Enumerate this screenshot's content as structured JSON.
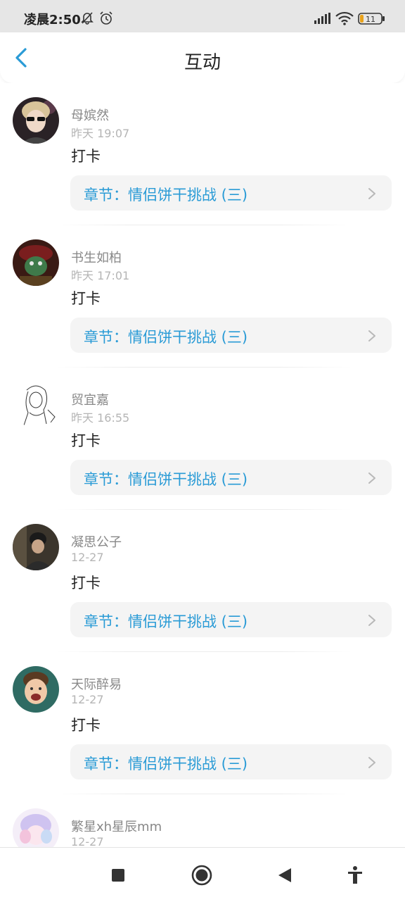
{
  "status_bar": {
    "time": "凌晨2:50",
    "battery": "11",
    "icons": [
      "bell-off-icon",
      "alarm-icon",
      "signal-icon",
      "wifi-icon",
      "battery-icon"
    ]
  },
  "header": {
    "title": "互动",
    "back_icon": "chevron-left-icon"
  },
  "colors": {
    "accent": "#2a9bd6",
    "chip_bg": "#f4f4f4",
    "muted_text": "#888888"
  },
  "interactions": [
    {
      "user": "母嫔然",
      "time": "昨天 19:07",
      "content": "打卡",
      "chapter": "章节：情侣饼干挑战 (三)"
    },
    {
      "user": "书生如柏",
      "time": "昨天 17:01",
      "content": "打卡",
      "chapter": "章节：情侣饼干挑战 (三)"
    },
    {
      "user": "贸宜嘉",
      "time": "昨天 16:55",
      "content": "打卡",
      "chapter": "章节：情侣饼干挑战 (三)"
    },
    {
      "user": "凝思公子",
      "time": "12-27",
      "content": "打卡",
      "chapter": "章节：情侣饼干挑战 (三)"
    },
    {
      "user": "天际醉易",
      "time": "12-27",
      "content": "打卡",
      "chapter": "章节：情侣饼干挑战 (三)"
    },
    {
      "user": "繁星xh星辰mm",
      "time": "12-27",
      "content": "",
      "chapter": ""
    }
  ],
  "bottom_nav": [
    "recents-square-icon",
    "home-circle-icon",
    "back-triangle-icon",
    "accessibility-icon"
  ]
}
